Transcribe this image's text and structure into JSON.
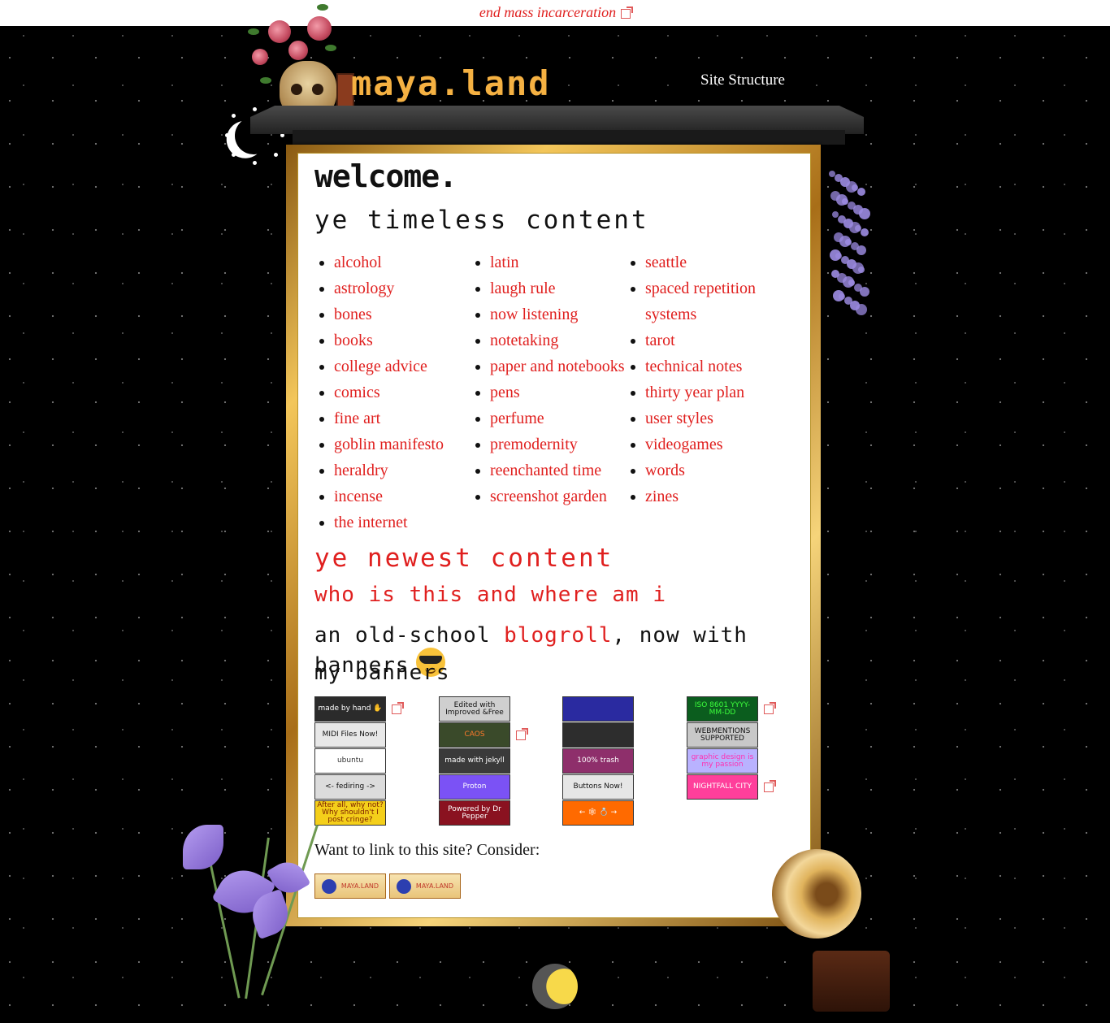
{
  "topbar": {
    "link": "end mass incarceration"
  },
  "header": {
    "logo": "maya.land",
    "nav_link": "Site Structure"
  },
  "page": {
    "welcome": "welcome.",
    "timeless_heading": "ye timeless content",
    "columns": [
      [
        "alcohol",
        "astrology",
        "bones",
        "books",
        "college advice",
        "comics",
        "fine art",
        "goblin manifesto",
        "heraldry",
        "incense",
        "the internet"
      ],
      [
        "latin",
        "laugh rule",
        "now listening",
        "notetaking",
        "paper and notebooks",
        "pens",
        "perfume",
        "premodernity",
        "reenchanted time",
        "screenshot garden"
      ],
      [
        "seattle",
        "spaced repetition systems",
        "tarot",
        "technical notes",
        "thirty year plan",
        "user styles",
        "videogames",
        "words",
        "zines"
      ]
    ],
    "newest_heading": "ye newest content",
    "who_heading": "who is this and where am i",
    "blogroll_prefix": "an old-school ",
    "blogroll_link": "blogroll",
    "blogroll_suffix": ", now with banners",
    "banners_heading": "my banners",
    "banners": [
      {
        "text": "made by hand ✋",
        "bg": "#2b2b2b",
        "fg": "#ffffff",
        "ext": true
      },
      {
        "text": "Edited with Improved &Free",
        "bg": "#cfcfcf",
        "fg": "#111111",
        "ext": false
      },
      {
        "text": "",
        "bg": "#2a2aa0",
        "fg": "#ffffff",
        "ext": false
      },
      {
        "text": "ISO 8601 YYYY-MM-DD",
        "bg": "#0b5d1e",
        "fg": "#3cff3c",
        "ext": true
      },
      {
        "text": "MIDI Files Now!",
        "bg": "#e8e8e8",
        "fg": "#111111",
        "ext": false
      },
      {
        "text": "CAOS",
        "bg": "#3a4a2a",
        "fg": "#ff7a2a",
        "ext": true
      },
      {
        "text": "",
        "bg": "#2d2d2d",
        "fg": "#ffffff",
        "ext": false
      },
      {
        "text": "WEBMENTIONS SUPPORTED",
        "bg": "#c8c8c8",
        "fg": "#111111",
        "ext": false
      },
      {
        "text": "ubuntu",
        "bg": "#ffffff",
        "fg": "#333333",
        "ext": false
      },
      {
        "text": "made with jekyll",
        "bg": "#3a3a3a",
        "fg": "#ffffff",
        "ext": false
      },
      {
        "text": "100% trash",
        "bg": "#8e2f6b",
        "fg": "#ffffff",
        "ext": false
      },
      {
        "text": "graphic design is my passion",
        "bg": "#b9b2ff",
        "fg": "#ff2fb1",
        "ext": false
      },
      {
        "text": "<- fediring ->",
        "bg": "#dcdcdc",
        "fg": "#111111",
        "ext": false
      },
      {
        "text": "Proton",
        "bg": "#7b52f5",
        "fg": "#ffffff",
        "ext": false
      },
      {
        "text": "Buttons Now!",
        "bg": "#e6e6e6",
        "fg": "#111111",
        "ext": false
      },
      {
        "text": "NIGHTFALL CITY",
        "bg": "#ff3f9b",
        "fg": "#ffffff",
        "ext": true
      },
      {
        "text": "After all, why not? Why shouldn't I post cringe?",
        "bg": "#f4cf1a",
        "fg": "#7a1d00",
        "ext": false
      },
      {
        "text": "Powered by Dr Pepper",
        "bg": "#8a1220",
        "fg": "#ffffff",
        "ext": false
      },
      {
        "text": "← 🕸 💍 →",
        "bg": "#ff6a00",
        "fg": "#ffffff",
        "ext": false
      }
    ],
    "link_prompt": "Want to link to this site? Consider:",
    "my_buttons": [
      "MAYA.LAND",
      "MAYA.LAND"
    ]
  },
  "colors": {
    "link": "#e0201f",
    "logo": "#f5b142",
    "frame": "#d4a23a"
  }
}
